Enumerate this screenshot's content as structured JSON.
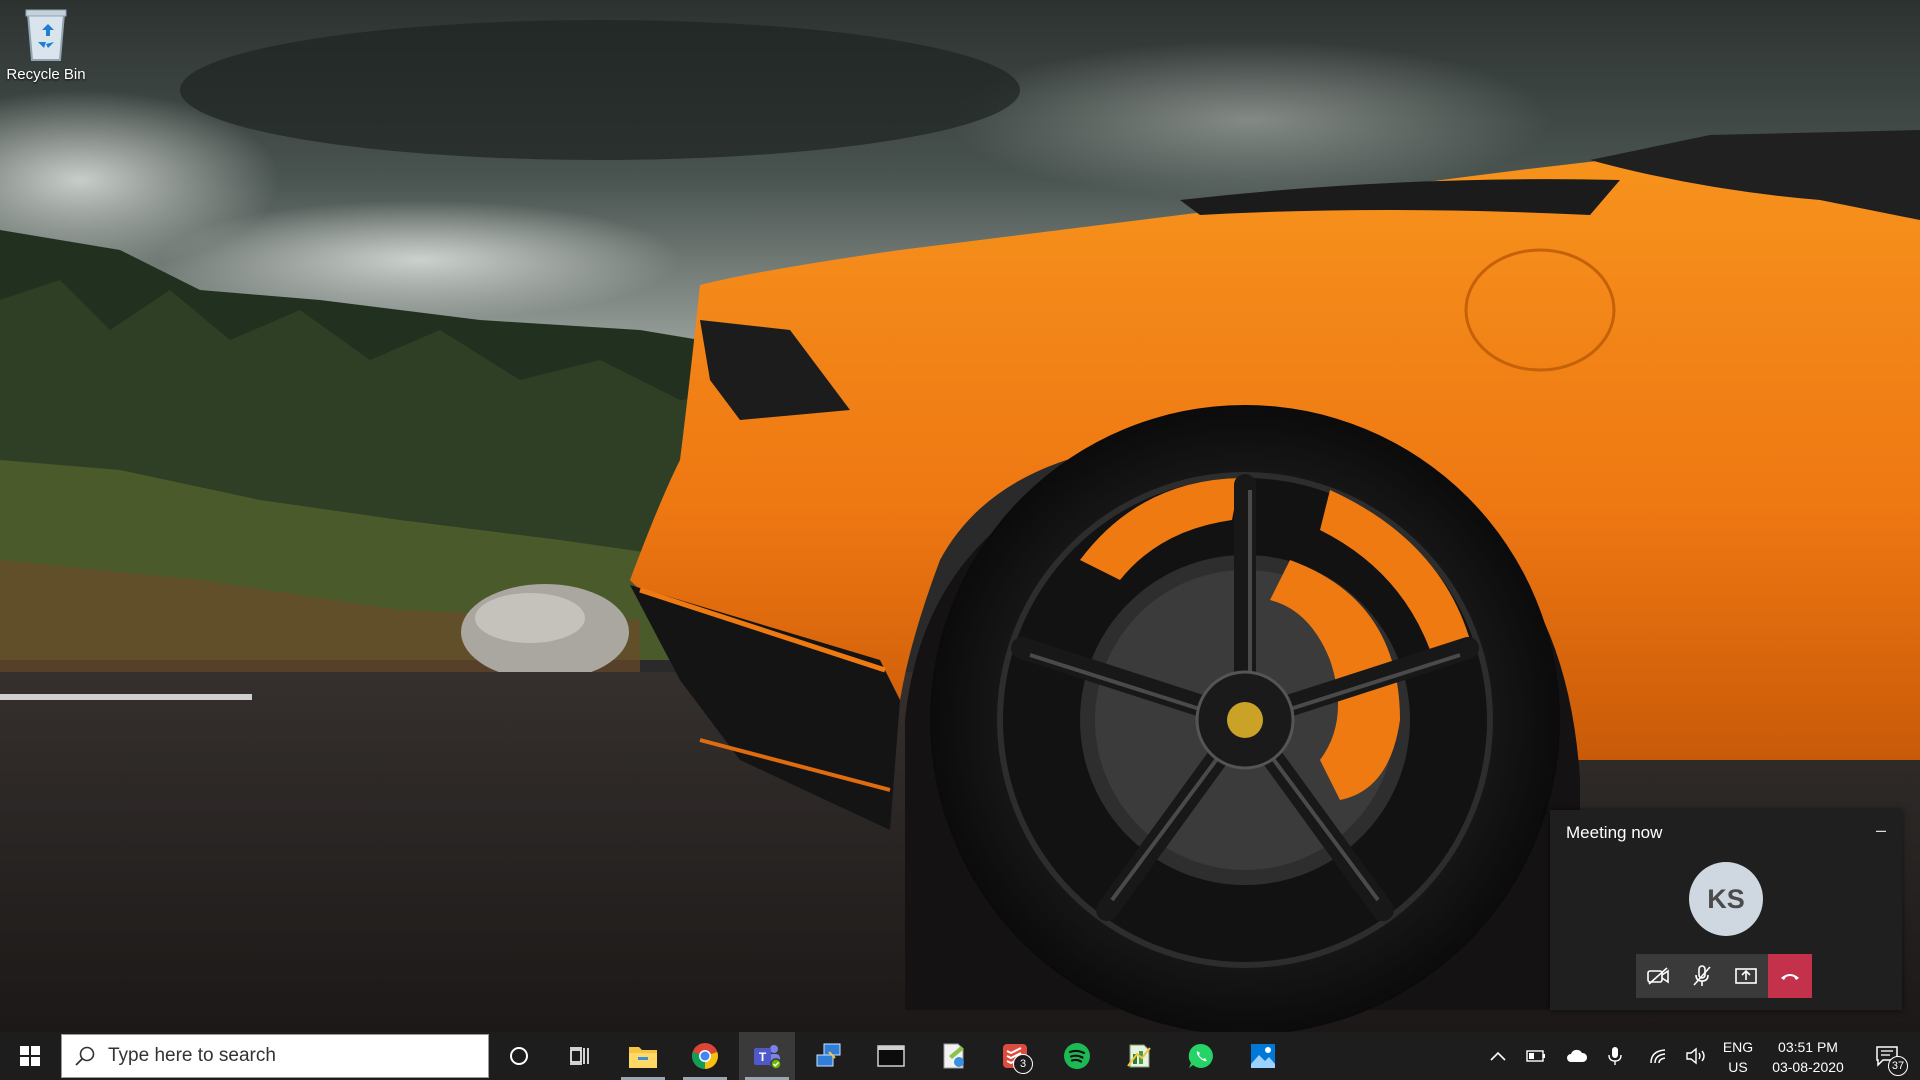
{
  "desktop": {
    "recycle_bin_label": "Recycle Bin"
  },
  "meeting": {
    "title": "Meeting now",
    "minimize": "–",
    "avatar_initials": "KS",
    "controls": [
      "camera-off-icon",
      "mic-off-icon",
      "share-screen-icon",
      "hang-up-icon"
    ],
    "hangup_color": "#c4314b"
  },
  "taskbar": {
    "search_placeholder": "Type here to search",
    "apps": [
      "file-explorer",
      "chrome",
      "teams",
      "remote-desktop",
      "terminal",
      "notepad-plus",
      "todoist",
      "spotify",
      "excel",
      "whatsapp",
      "photos"
    ],
    "todoist_badge": "3",
    "language": {
      "line1": "ENG",
      "line2": "US"
    },
    "time": "03:51 PM",
    "date": "03-08-2020",
    "notification_count": "37"
  },
  "colors": {
    "taskbar": "#1d1d1d",
    "car_orange": "#f07a12"
  }
}
